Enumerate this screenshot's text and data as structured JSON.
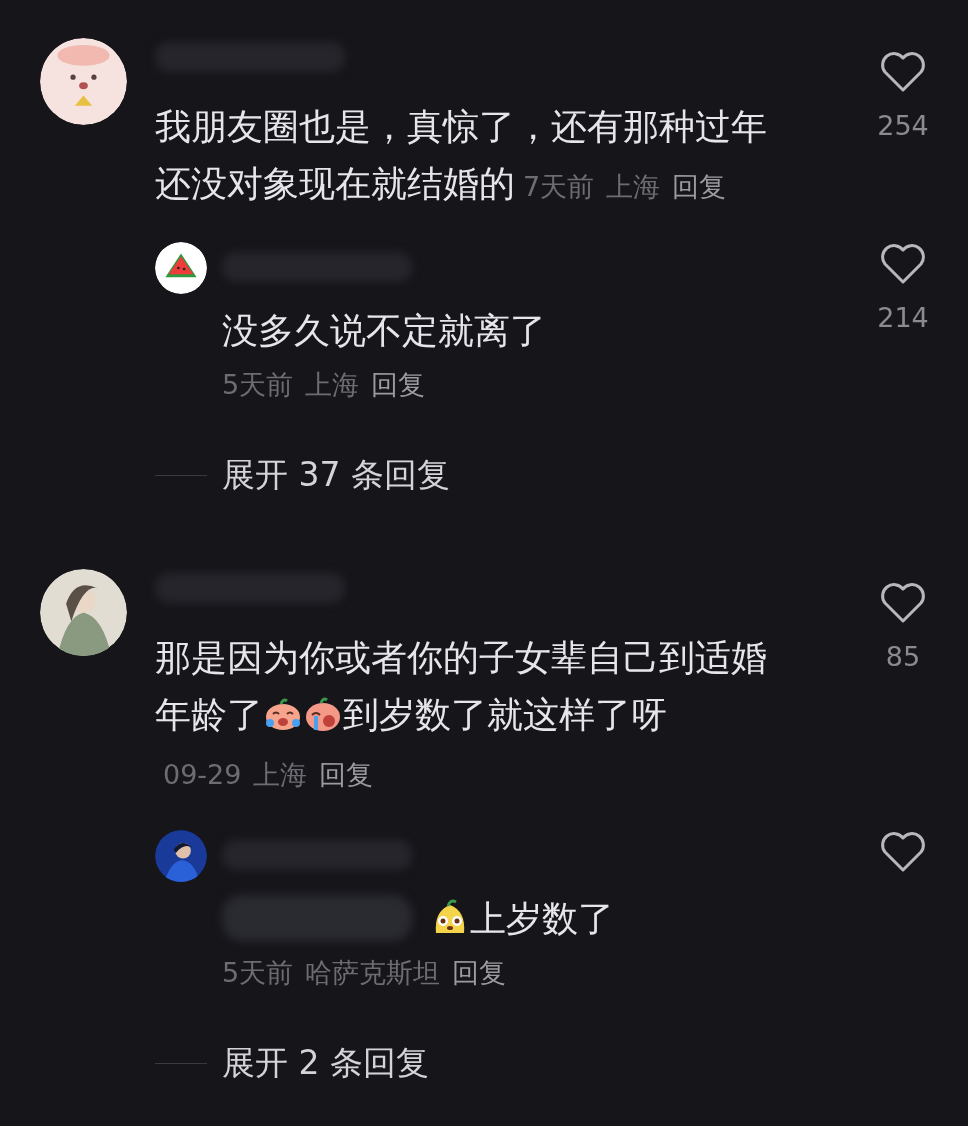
{
  "comments": [
    {
      "avatar": {
        "kind": "cartoon"
      },
      "lines": [
        [
          {
            "kind": "text",
            "text": "我朋友圈也是，真惊了，还有那种过年"
          }
        ],
        [
          {
            "kind": "text",
            "text": "还没对象现在就结婚的"
          }
        ]
      ],
      "time": "7天前",
      "location": "上海",
      "reply_label": "回复",
      "likes": "254",
      "replies": [
        {
          "avatar": {
            "kind": "watermelon"
          },
          "lines": [
            [
              {
                "kind": "text",
                "text": "没多久说不定就离了"
              }
            ]
          ],
          "time": "5天前",
          "location": "上海",
          "reply_label": "回复",
          "likes": "214"
        }
      ],
      "expand_label": "展开 37 条回复"
    },
    {
      "avatar": {
        "kind": "figure"
      },
      "lines": [
        [
          {
            "kind": "text",
            "text": "那是因为你或者你的子女辈自己到适婚"
          }
        ],
        [
          {
            "kind": "text",
            "text": "年龄了"
          },
          {
            "kind": "cry"
          },
          {
            "kind": "sob"
          },
          {
            "kind": "text",
            "text": "到岁数了就这样了呀"
          }
        ]
      ],
      "time": "09-29",
      "location": "上海",
      "reply_label": "回复",
      "likes": "85",
      "replies": [
        {
          "avatar": {
            "kind": "figure_blue"
          },
          "lines": [
            [
              {
                "kind": "blur"
              },
              {
                "kind": "grin"
              },
              {
                "kind": "text",
                "text": "上岁数了"
              }
            ]
          ],
          "time": "5天前",
          "location": "哈萨克斯坦",
          "reply_label": "回复"
        }
      ],
      "expand_label": "展开 2 条回复"
    }
  ]
}
